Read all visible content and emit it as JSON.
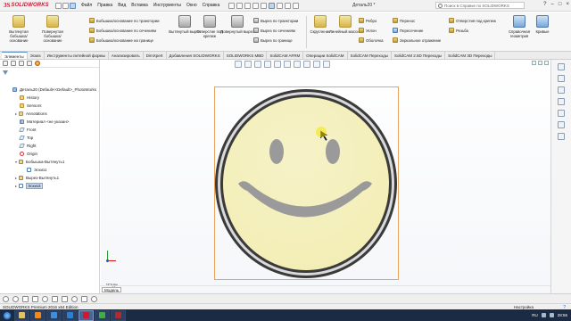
{
  "titlebar": {
    "brand_prefix": "3S",
    "brand": "SOLIDWORKS",
    "menus": [
      "Файл",
      "Правка",
      "Вид",
      "Вставка",
      "Инструменты",
      "Окно",
      "Справка"
    ],
    "document_title": "Деталь20 *",
    "search_placeholder": "Поиск в Справке по SOLIDWORKS",
    "window_controls": [
      "?",
      "–",
      "□",
      "×"
    ]
  },
  "ribbon": {
    "big_buttons": [
      {
        "label": "Вытянутая бобышка/основание",
        "icon": "extrude-boss-icon"
      },
      {
        "label": "Повернутая бобышка/основание",
        "icon": "revolve-boss-icon"
      },
      {
        "label": "Вытянутый вырез",
        "icon": "extrude-cut-icon"
      },
      {
        "label": "Отверстие под крепеж",
        "icon": "hole-wizard-icon"
      },
      {
        "label": "Повернутый вырез",
        "icon": "revolve-cut-icon"
      },
      {
        "label": "Скругление",
        "icon": "fillet-icon"
      },
      {
        "label": "Линейный массив",
        "icon": "linear-pattern-icon"
      },
      {
        "label": "Справочная геометрия",
        "icon": "reference-geometry-icon"
      },
      {
        "label": "Кривые",
        "icon": "curves-icon"
      }
    ],
    "small_buttons": [
      {
        "label": "Бобышка/основание по траектории",
        "icon": "sweep-boss-icon"
      },
      {
        "label": "Бобышка/основание по сечениям",
        "icon": "loft-boss-icon"
      },
      {
        "label": "Бобышка/основание на границе",
        "icon": "boundary-boss-icon"
      },
      {
        "label": "Вырез по траектории",
        "icon": "sweep-cut-icon"
      },
      {
        "label": "Вырез по сечениям",
        "icon": "loft-cut-icon"
      },
      {
        "label": "Вырез по границе",
        "icon": "boundary-cut-icon"
      },
      {
        "label": "Ребро",
        "icon": "rib-icon"
      },
      {
        "label": "Уклон",
        "icon": "draft-icon"
      },
      {
        "label": "Оболочка",
        "icon": "shell-icon"
      },
      {
        "label": "Перенос",
        "icon": "wrap-icon"
      },
      {
        "label": "Пересечение",
        "icon": "intersect-icon"
      },
      {
        "label": "Зеркальное отражение",
        "icon": "mirror-icon"
      },
      {
        "label": "Отверстия под крепеж",
        "icon": "hole-series-icon"
      },
      {
        "label": "Резьба",
        "icon": "thread-icon"
      }
    ]
  },
  "tabs": [
    "Элементы",
    "Эскиз",
    "Инструменты литейной формы",
    "Анализировать",
    "DimXpert",
    "Добавления SOLIDWORKS",
    "SOLIDWORKS MBD",
    "SolidCAM AFRM",
    "Операции SolidCAM",
    "SolidCAM Переходы",
    "SolidCAM 2.5D Переходы",
    "SolidCAM 3D Переходы"
  ],
  "active_tab": "Элементы",
  "tree": {
    "root": "Деталь20 (Default<<Default>_PhotoWorks",
    "items": [
      {
        "label": "History",
        "icon": "folder",
        "arrow": ""
      },
      {
        "label": "Sensors",
        "icon": "folder",
        "arrow": ""
      },
      {
        "label": "Annotations",
        "icon": "folder",
        "arrow": "▸"
      },
      {
        "label": "Материал <не указан>",
        "icon": "mat",
        "arrow": ""
      },
      {
        "label": "Front",
        "icon": "plane",
        "arrow": ""
      },
      {
        "label": "Top",
        "icon": "plane",
        "arrow": ""
      },
      {
        "label": "Right",
        "icon": "plane",
        "arrow": ""
      },
      {
        "label": "Origin",
        "icon": "origin",
        "arrow": ""
      },
      {
        "label": "Бобышка-Вытянуть1",
        "icon": "feat",
        "arrow": "▾"
      },
      {
        "label": "Эскиз1",
        "icon": "sketch",
        "arrow": ""
      },
      {
        "label": "Вырез-Вытянуть1",
        "icon": "feat",
        "arrow": "▸"
      },
      {
        "label": "Эскиз3",
        "icon": "sketch",
        "arrow": "▸"
      }
    ]
  },
  "viewport": {
    "view_label": "*Спди",
    "smiley_face_color": "#f3eeb5",
    "smiley_feature_color": "#9a9a9a",
    "ring_color": "#3a3a3a",
    "sketch_frame_color": "#e9a35c"
  },
  "bottom": {
    "model_tab": "Модель"
  },
  "statusbar": {
    "left_text": "SOLIDWORKS Premium 2016 x64 Edition",
    "right_text": "Настройка"
  },
  "taskbar": {
    "apps": [
      {
        "name": "explorer",
        "color": "#e8c15c"
      },
      {
        "name": "media-player",
        "color": "#f08a1c"
      },
      {
        "name": "browser",
        "color": "#3b8ee0"
      },
      {
        "name": "photoshop",
        "color": "#2f7fd0"
      },
      {
        "name": "solidworks",
        "color": "#d3172e"
      },
      {
        "name": "chrome",
        "color": "#3fae4a"
      },
      {
        "name": "solidworks-app",
        "color": "#b22a2a"
      }
    ],
    "lang": "RU",
    "time": "28:55"
  }
}
